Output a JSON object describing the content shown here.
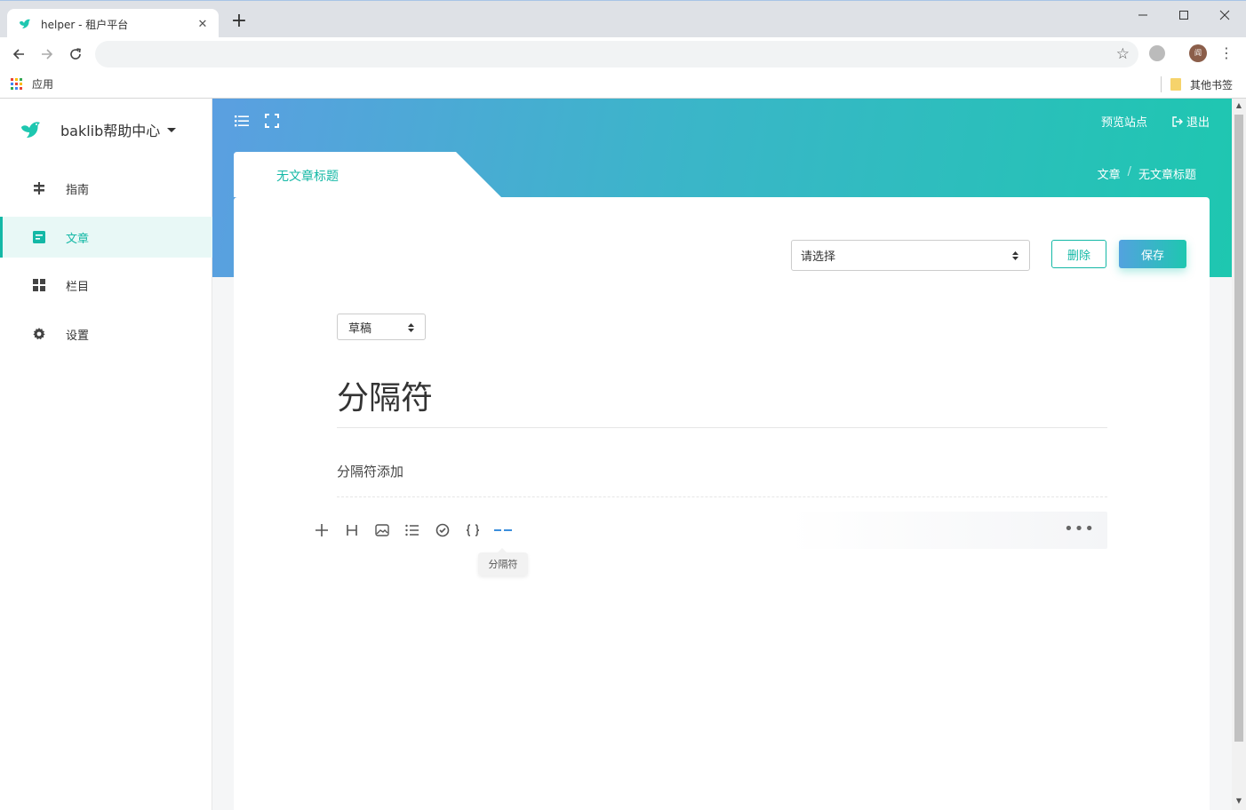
{
  "browser": {
    "tab_title": "helper - 租户平台",
    "tab_close": "✕",
    "new_tab": "+",
    "bookmark_apps": "应用",
    "bookmark_other": "其他书签",
    "avatar_letter": "阎"
  },
  "sidebar": {
    "brand_name": "baklib帮助中心",
    "items": [
      {
        "label": "指南",
        "icon": "signpost-icon",
        "active": false
      },
      {
        "label": "文章",
        "icon": "article-icon",
        "active": true
      },
      {
        "label": "栏目",
        "icon": "grid-icon",
        "active": false
      },
      {
        "label": "设置",
        "icon": "gear-icon",
        "active": false
      }
    ]
  },
  "header": {
    "preview_label": "预览站点",
    "logout_label": "退出"
  },
  "card": {
    "tab_label": "无文章标题",
    "breadcrumb": [
      "文章",
      "无文章标题"
    ],
    "breadcrumb_sep": "/",
    "channel_select_value": "请选择",
    "delete_label": "删除",
    "save_label": "保存",
    "status_select_value": "草稿",
    "doc_title": "分隔符",
    "doc_paragraph": "分隔符添加",
    "toolbar_more": "•••",
    "tooltip": "分隔符"
  },
  "colors": {
    "accent": "#14b8a6",
    "gradient_start": "#5b9fe1",
    "gradient_end": "#1ec7b0",
    "active_tool": "#3b8fdc"
  }
}
